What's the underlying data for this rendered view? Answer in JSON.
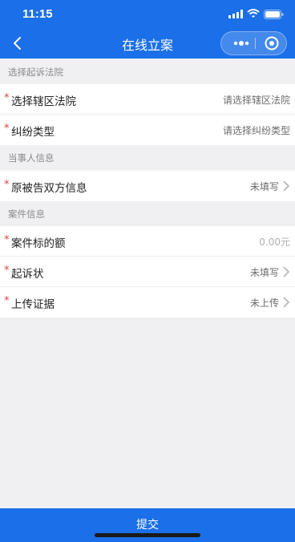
{
  "status_bar": {
    "time": "11:15"
  },
  "nav": {
    "title": "在线立案"
  },
  "sections": {
    "court": {
      "title": "选择起诉法院",
      "rows": [
        {
          "label": "选择辖区法院",
          "value": "请选择辖区法院"
        },
        {
          "label": "纠纷类型",
          "value": "请选择纠纷类型"
        }
      ]
    },
    "party": {
      "title": "当事人信息",
      "rows": [
        {
          "label": "原被告双方信息",
          "value": "未填写"
        }
      ]
    },
    "case": {
      "title": "案件信息",
      "rows": [
        {
          "label": "案件标的额",
          "value": "0.00元"
        },
        {
          "label": "起诉状",
          "value": "未填写"
        },
        {
          "label": "上传证据",
          "value": "未上传"
        }
      ]
    }
  },
  "required_mark": "*",
  "submit": {
    "label": "提交"
  },
  "colors": {
    "primary": "#1b6fe8",
    "required": "#e23d3d",
    "background": "#f0f0f3"
  }
}
